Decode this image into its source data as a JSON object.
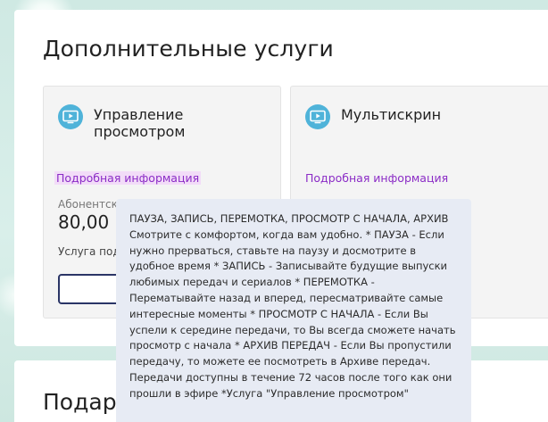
{
  "section": {
    "title": "Дополнительные услуги",
    "next_title": "Подарки"
  },
  "cards": [
    {
      "icon": "tv-play-icon",
      "title": "Управление просмотром",
      "more_link": "Подробная информация",
      "price_label": "Абонентская плата",
      "price_value": "80,00",
      "note": "Услуга подключена"
    },
    {
      "icon": "tv-play-icon",
      "title": "Мультискрин",
      "more_link": "Подробная информация"
    }
  ],
  "tooltip": {
    "text": "ПАУЗА, ЗАПИСЬ, ПЕРЕМОТКА, ПРОСМОТР С НАЧАЛА, АРХИВ Смотрите с комфортом, когда вам удобно. * ПАУЗА - Если нужно прерваться, ставьте на паузу и досмотрите в удобное время * ЗАПИСЬ - Записывайте будущие выпуски любимых передач и сериалов * ПЕРЕМОТКА - Перематывайте назад и вперед, пересматривайте самые интересные моменты * ПРОСМОТР С НАЧАЛА - Если Вы успели к середине передачи, то Вы всегда сможете начать просмотр с начала * АРХИВ ПЕРЕДАЧ - Если Вы пропустили передачу, то можете ее посмотреть в Архиве передач. Передачи доступны в течение 72 часов после того как они прошли в эфире *Услуга \"Управление просмотром\""
  },
  "colors": {
    "accent_link": "#8b2cc6",
    "icon_blue": "#4fb3d9",
    "button_border": "#2a3566",
    "tooltip_bg": "#e7ebf4"
  }
}
